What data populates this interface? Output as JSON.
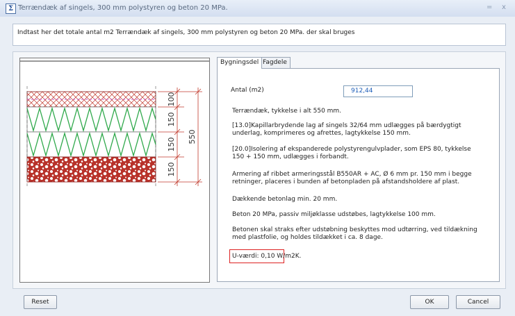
{
  "window": {
    "title": "Terrændæk af singels, 300 mm polystyren og beton 20 MPa.",
    "minimize_glyph": "=",
    "close_glyph": "x"
  },
  "instruction": "Indtast her det totale antal m2 Terrændæk af singels, 300 mm polystyren og beton 20 MPa. der skal bruges",
  "drawing": {
    "dimensions": [
      "100",
      "150",
      "150",
      "150"
    ],
    "total": "550",
    "colors": {
      "hatch": "#c0392b",
      "zigzag": "#2ea84a",
      "gravel": "#c0392b",
      "dims": "#c0392b"
    }
  },
  "tabs": [
    {
      "label": "Bygningsdel",
      "active": true
    },
    {
      "label": "Fagdele",
      "active": false
    }
  ],
  "quantity": {
    "label": "Antal (m2)",
    "value": "912,44"
  },
  "paragraphs": [
    "Terrændæk, tykkelse i alt 550 mm.",
    "[13.0]Kapillarbrydende lag af singels 32/64 mm udlægges på bærdygtigt underlag, komprimeres og afrettes, lagtykkelse 150 mm.",
    "[20.0]Isolering af ekspanderede polystyrengulvplader, som EPS 80, tykkelse 150 + 150 mm, udlægges i forbandt.",
    "Armering af ribbet armeringsstål B550AR + AC, Ø 6 mm pr. 150 mm i begge retninger, placeres i bunden af betonpladen på afstandsholdere af plast.",
    "Dækkende betonlag min. 20 mm.",
    "Beton 20 MPa, passiv miljøklasse udstøbes, lagtykkelse 100 mm.",
    "Betonen skal straks efter udstøbning beskyttes mod udtørring, ved tildækning med plastfolie, og holdes tildækket i ca. 8 dage."
  ],
  "u_value": "U-værdi: 0,10 W/m2K.",
  "buttons": {
    "reset": "Reset",
    "ok": "OK",
    "cancel": "Cancel"
  }
}
